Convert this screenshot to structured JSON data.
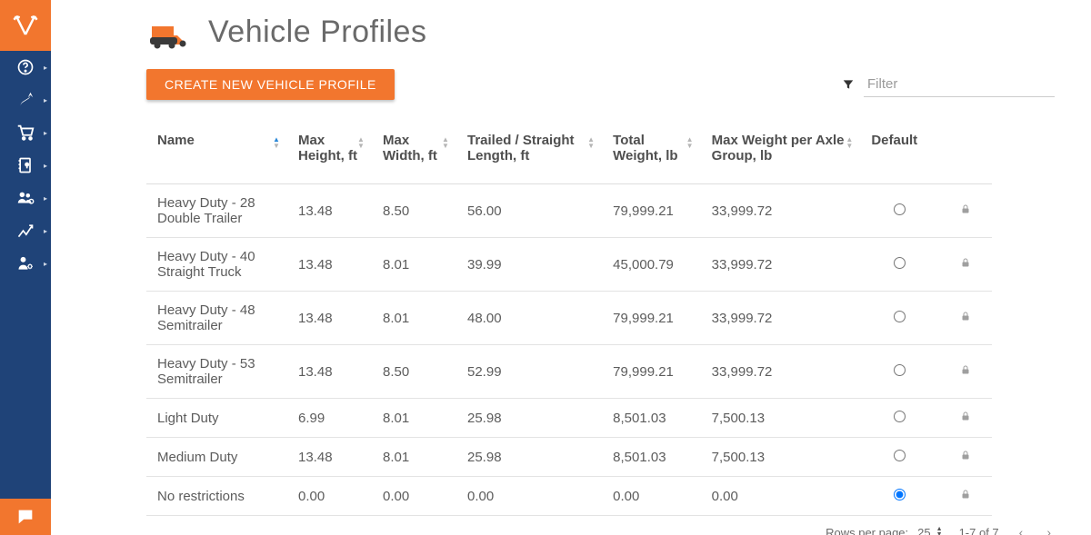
{
  "page": {
    "title": "Vehicle Profiles"
  },
  "toolbar": {
    "create_label": "CREATE NEW VEHICLE PROFILE"
  },
  "filter": {
    "placeholder": "Filter",
    "value": ""
  },
  "table": {
    "headers": {
      "name": "Name",
      "max_height": "Max Height, ft",
      "max_width": "Max Width, ft",
      "length": "Trailed / Straight Length, ft",
      "total_weight": "Total Weight, lb",
      "axle_weight": "Max Weight per Axle Group, lb",
      "default": "Default"
    },
    "rows": [
      {
        "name": "Heavy Duty - 28 Double Trailer",
        "max_height": "13.48",
        "max_width": "8.50",
        "length": "56.00",
        "total_weight": "79,999.21",
        "axle_weight": "33,999.72",
        "default": false,
        "locked": true
      },
      {
        "name": "Heavy Duty - 40 Straight Truck",
        "max_height": "13.48",
        "max_width": "8.01",
        "length": "39.99",
        "total_weight": "45,000.79",
        "axle_weight": "33,999.72",
        "default": false,
        "locked": true
      },
      {
        "name": "Heavy Duty - 48 Semitrailer",
        "max_height": "13.48",
        "max_width": "8.01",
        "length": "48.00",
        "total_weight": "79,999.21",
        "axle_weight": "33,999.72",
        "default": false,
        "locked": true
      },
      {
        "name": "Heavy Duty - 53 Semitrailer",
        "max_height": "13.48",
        "max_width": "8.50",
        "length": "52.99",
        "total_weight": "79,999.21",
        "axle_weight": "33,999.72",
        "default": false,
        "locked": true
      },
      {
        "name": "Light Duty",
        "max_height": "6.99",
        "max_width": "8.01",
        "length": "25.98",
        "total_weight": "8,501.03",
        "axle_weight": "7,500.13",
        "default": false,
        "locked": true
      },
      {
        "name": "Medium Duty",
        "max_height": "13.48",
        "max_width": "8.01",
        "length": "25.98",
        "total_weight": "8,501.03",
        "axle_weight": "7,500.13",
        "default": false,
        "locked": true
      },
      {
        "name": "No restrictions",
        "max_height": "0.00",
        "max_width": "0.00",
        "length": "0.00",
        "total_weight": "0.00",
        "axle_weight": "0.00",
        "default": true,
        "locked": true
      }
    ]
  },
  "pager": {
    "rows_per_page_label": "Rows per page:",
    "rows_per_page_value": "25",
    "range": "1-7 of 7"
  },
  "sidebar": {
    "items": [
      {
        "id": "help",
        "icon": "question-circle-icon"
      },
      {
        "id": "routes",
        "icon": "route-arrows-icon"
      },
      {
        "id": "orders",
        "icon": "cart-icon"
      },
      {
        "id": "addresses",
        "icon": "book-pin-icon"
      },
      {
        "id": "team",
        "icon": "people-pin-icon"
      },
      {
        "id": "analytics",
        "icon": "chart-up-icon"
      },
      {
        "id": "admin",
        "icon": "user-gear-icon"
      }
    ]
  }
}
